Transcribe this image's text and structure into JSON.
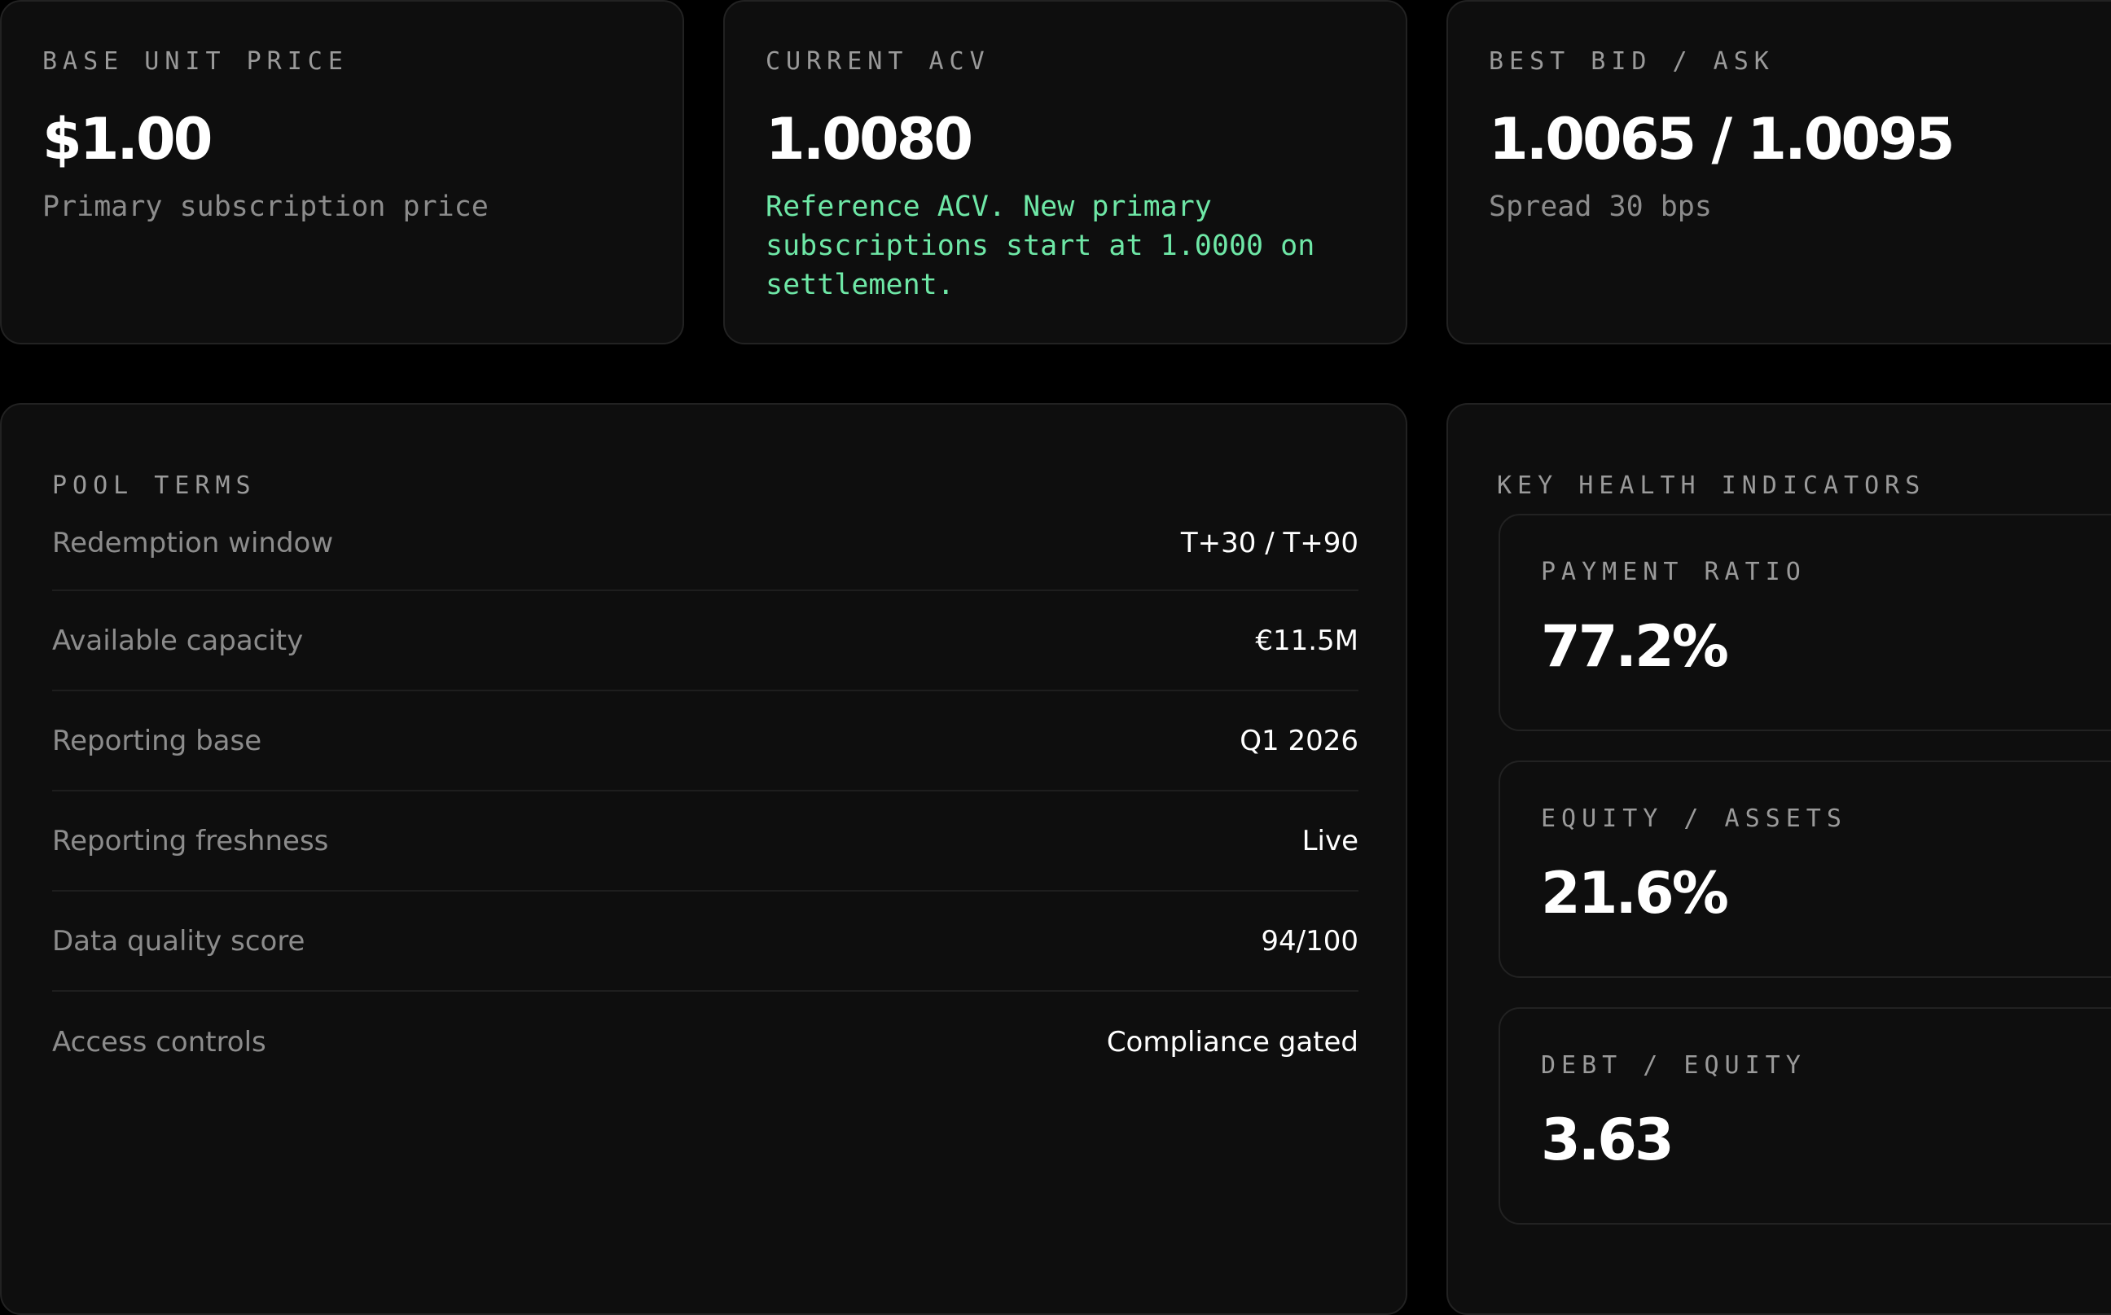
{
  "summary_cards": {
    "base_unit_price": {
      "label": "BASE UNIT PRICE",
      "value": "$1.00",
      "caption": "Primary subscription price"
    },
    "current_acv": {
      "label": "CURRENT ACV",
      "value": "1.0080",
      "caption": "Reference ACV. New primary subscriptions start at 1.0000 on settlement."
    },
    "best_bid_ask": {
      "label": "BEST BID / ASK",
      "value": "1.0065 / 1.0095",
      "caption": "Spread 30 bps"
    }
  },
  "pool_terms": {
    "title": "POOL TERMS",
    "rows": [
      {
        "label": "Redemption window",
        "value": "T+30 / T+90"
      },
      {
        "label": "Available capacity",
        "value": "€11.5M"
      },
      {
        "label": "Reporting base",
        "value": "Q1 2026"
      },
      {
        "label": "Reporting freshness",
        "value": "Live"
      },
      {
        "label": "Data quality score",
        "value": "94/100"
      },
      {
        "label": "Access controls",
        "value": "Compliance gated"
      }
    ]
  },
  "health": {
    "title": "KEY HEALTH INDICATORS",
    "indicators": [
      {
        "label": "PAYMENT RATIO",
        "value": "77.2%"
      },
      {
        "label": "EQUITY / ASSETS",
        "value": "21.6%"
      },
      {
        "label": "DEBT / EQUITY",
        "value": "3.63"
      }
    ]
  },
  "colors": {
    "background": "#000000",
    "card": "#0e0e0e",
    "border": "#222222",
    "accent_green": "#6ee7a6",
    "muted_text": "#8c8c8c"
  }
}
